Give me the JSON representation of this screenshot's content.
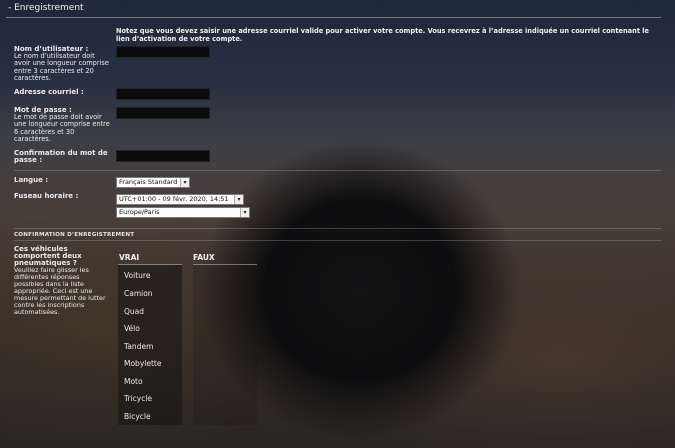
{
  "header": {
    "title": "- Enregistrement"
  },
  "notice": "Notez que vous devez saisir une adresse courriel valide pour activer votre compte. Vous recevrez à l’adresse indiquée un courriel contenant le lien d’activation de votre compte.",
  "fields": {
    "username": {
      "label": "Nom d’utilisateur :",
      "help": "Le nom d’utilisateur doit avoir une longueur comprise entre 3 caractères et 20 caractères.",
      "value": ""
    },
    "email": {
      "label": "Adresse courriel :",
      "value": ""
    },
    "password": {
      "label": "Mot de passe :",
      "help": "Le mot de passe doit avoir une longueur comprise entre 6 caractères et 30 caractères.",
      "value": ""
    },
    "password_confirm": {
      "label": "Confirmation du mot de passe :",
      "value": ""
    }
  },
  "language": {
    "label": "Langue :",
    "selected": "Français Standard"
  },
  "timezone": {
    "label": "Fuseau horaire :",
    "selected": "UTC+01:00 - 09 févr. 2020, 14:51",
    "region": "Europe/Paris"
  },
  "confirmation": {
    "title": "CONFIRMATION D’ENREGISTREMENT",
    "question": "Ces véhicules comportent deux pneumatiques ?",
    "help": "Veuillez faire glisser les différentes réponses possibles dans la liste appropriée. Ceci est une mesure permettant de lutter contre les inscriptions automatisées.",
    "true_label": "VRAI",
    "false_label": "FAUX",
    "items": [
      "Voiture",
      "Camion",
      "Quad",
      "Vélo",
      "Tandem",
      "Mobylette",
      "Moto",
      "Tricycle",
      "Bicycle"
    ]
  }
}
